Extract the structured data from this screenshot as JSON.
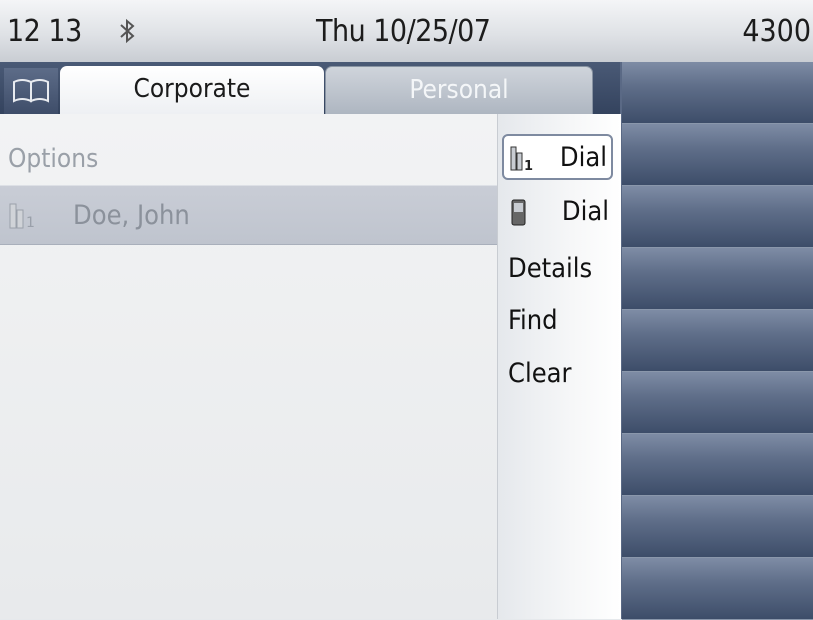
{
  "status_bar": {
    "time": "12 13",
    "date": "Thu 10/25/07",
    "extension": "4300",
    "bluetooth_icon": "bluetooth-icon"
  },
  "tabs": [
    {
      "label": "Corporate",
      "active": true
    },
    {
      "label": "Personal",
      "active": false
    }
  ],
  "phonebook_icon": "book-icon",
  "content": {
    "heading": "Options",
    "entries": [
      {
        "name": "Doe, John",
        "icon": "office-phone-1-icon"
      }
    ]
  },
  "menu": {
    "items": [
      {
        "label": "Dial",
        "icon": "office-phone-1-icon",
        "selected": true
      },
      {
        "label": "Dial",
        "icon": "mobile-phone-icon",
        "selected": false
      },
      {
        "label": "Details",
        "icon": null,
        "selected": false
      },
      {
        "label": "Find",
        "icon": null,
        "selected": false
      },
      {
        "label": "Clear",
        "icon": null,
        "selected": false
      }
    ]
  },
  "colors": {
    "panel_blue": "#3c4c67",
    "selection_border": "#7e8aa0",
    "highlight_row": "#c5c9d2"
  }
}
